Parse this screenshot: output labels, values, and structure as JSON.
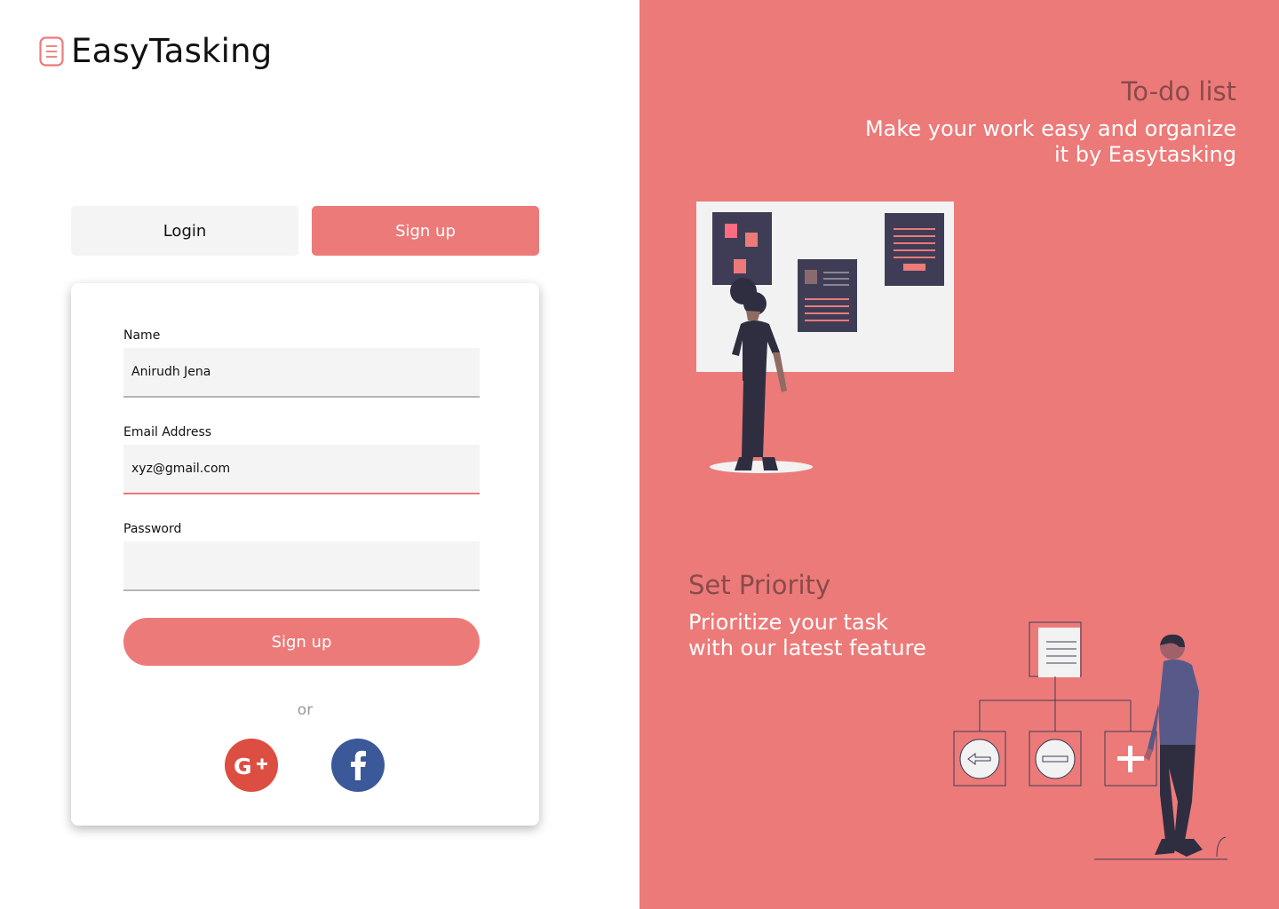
{
  "brand": {
    "name": "EasyTasking"
  },
  "tabs": {
    "login_label": "Login",
    "signup_label": "Sign up"
  },
  "form": {
    "name_label": "Name",
    "name_value": "Anirudh Jena",
    "email_label": "Email Address",
    "email_value": "xyz@gmail.com",
    "password_label": "Password",
    "password_value": "",
    "submit_label": "Sign up",
    "or_label": "or"
  },
  "social": {
    "google_icon": "google-plus-icon",
    "facebook_icon": "facebook-icon"
  },
  "features": {
    "todo_title": "To-do list",
    "todo_line1": "Make your work easy and organize",
    "todo_line2": "it by Easytasking",
    "priority_title": "Set Priority",
    "priority_line1": "Prioritize your task",
    "priority_line2": "with our latest feature"
  },
  "colors": {
    "accent": "#ec7a79",
    "dark": "#3f3d56",
    "google": "#dc4e41",
    "facebook": "#3b5998"
  }
}
